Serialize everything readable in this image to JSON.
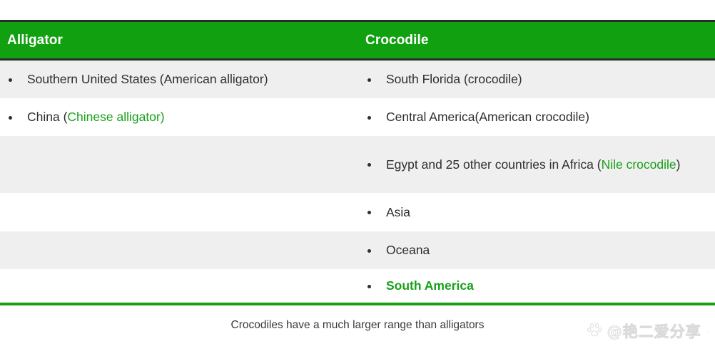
{
  "table": {
    "headers": {
      "left": "Alligator",
      "right": "Crocodile"
    },
    "header_bg": "#10a010",
    "header_text_color": "#ffffff",
    "accent_green": "#18a018",
    "stripe_gray": "#efefef",
    "stripe_white": "#ffffff",
    "left_column": [
      {
        "bullet": "•",
        "parts": [
          {
            "text": "Southern United States (American alligator)",
            "color": "black"
          }
        ]
      },
      {
        "bullet": "•",
        "parts": [
          {
            "text": "China (",
            "color": "black"
          },
          {
            "text": "Chinese alligator)",
            "color": "green"
          }
        ]
      },
      {
        "bullet": "",
        "parts": []
      },
      {
        "bullet": "",
        "parts": []
      },
      {
        "bullet": "",
        "parts": []
      },
      {
        "bullet": "",
        "parts": []
      }
    ],
    "right_column": [
      {
        "bullet": "•",
        "parts": [
          {
            "text": "South Florida (crocodile)",
            "color": "black"
          }
        ]
      },
      {
        "bullet": "•",
        "parts": [
          {
            "text": "Central America(American crocodile)",
            "color": "black"
          }
        ]
      },
      {
        "bullet": "•",
        "parts": [
          {
            "text": "Egypt and 25 other countries in Africa (",
            "color": "black"
          },
          {
            "text": "Nile crocodile",
            "color": "green"
          },
          {
            "text": ")",
            "color": "black"
          }
        ]
      },
      {
        "bullet": "•",
        "parts": [
          {
            "text": "Asia",
            "color": "black"
          }
        ]
      },
      {
        "bullet": "•",
        "parts": [
          {
            "text": "Oceana",
            "color": "black"
          }
        ]
      },
      {
        "bullet": "•",
        "parts": [
          {
            "text": "South America",
            "color": "green-bold"
          }
        ]
      }
    ]
  },
  "caption": "Crocodiles have a much larger range than alligators",
  "watermark": {
    "icon": "baidu-paw-icon",
    "at_symbol": "@",
    "text": "艳二爱分享"
  }
}
